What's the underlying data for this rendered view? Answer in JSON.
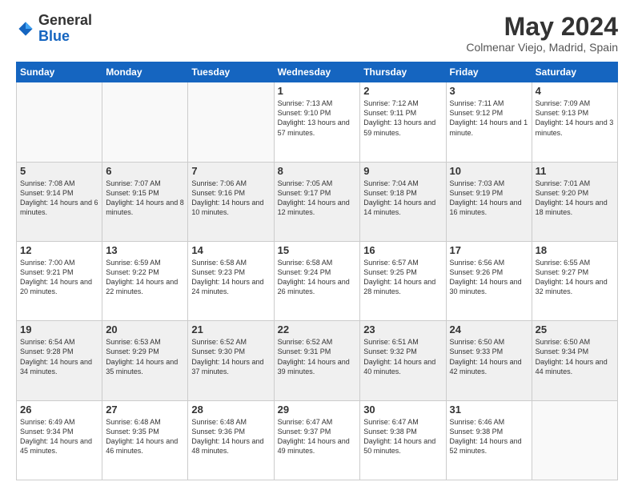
{
  "header": {
    "logo_general": "General",
    "logo_blue": "Blue",
    "month_title": "May 2024",
    "location": "Colmenar Viejo, Madrid, Spain"
  },
  "weekdays": [
    "Sunday",
    "Monday",
    "Tuesday",
    "Wednesday",
    "Thursday",
    "Friday",
    "Saturday"
  ],
  "weeks": [
    [
      {
        "day": "",
        "info": ""
      },
      {
        "day": "",
        "info": ""
      },
      {
        "day": "",
        "info": ""
      },
      {
        "day": "1",
        "info": "Sunrise: 7:13 AM\nSunset: 9:10 PM\nDaylight: 13 hours and 57 minutes."
      },
      {
        "day": "2",
        "info": "Sunrise: 7:12 AM\nSunset: 9:11 PM\nDaylight: 13 hours and 59 minutes."
      },
      {
        "day": "3",
        "info": "Sunrise: 7:11 AM\nSunset: 9:12 PM\nDaylight: 14 hours and 1 minute."
      },
      {
        "day": "4",
        "info": "Sunrise: 7:09 AM\nSunset: 9:13 PM\nDaylight: 14 hours and 3 minutes."
      }
    ],
    [
      {
        "day": "5",
        "info": "Sunrise: 7:08 AM\nSunset: 9:14 PM\nDaylight: 14 hours and 6 minutes."
      },
      {
        "day": "6",
        "info": "Sunrise: 7:07 AM\nSunset: 9:15 PM\nDaylight: 14 hours and 8 minutes."
      },
      {
        "day": "7",
        "info": "Sunrise: 7:06 AM\nSunset: 9:16 PM\nDaylight: 14 hours and 10 minutes."
      },
      {
        "day": "8",
        "info": "Sunrise: 7:05 AM\nSunset: 9:17 PM\nDaylight: 14 hours and 12 minutes."
      },
      {
        "day": "9",
        "info": "Sunrise: 7:04 AM\nSunset: 9:18 PM\nDaylight: 14 hours and 14 minutes."
      },
      {
        "day": "10",
        "info": "Sunrise: 7:03 AM\nSunset: 9:19 PM\nDaylight: 14 hours and 16 minutes."
      },
      {
        "day": "11",
        "info": "Sunrise: 7:01 AM\nSunset: 9:20 PM\nDaylight: 14 hours and 18 minutes."
      }
    ],
    [
      {
        "day": "12",
        "info": "Sunrise: 7:00 AM\nSunset: 9:21 PM\nDaylight: 14 hours and 20 minutes."
      },
      {
        "day": "13",
        "info": "Sunrise: 6:59 AM\nSunset: 9:22 PM\nDaylight: 14 hours and 22 minutes."
      },
      {
        "day": "14",
        "info": "Sunrise: 6:58 AM\nSunset: 9:23 PM\nDaylight: 14 hours and 24 minutes."
      },
      {
        "day": "15",
        "info": "Sunrise: 6:58 AM\nSunset: 9:24 PM\nDaylight: 14 hours and 26 minutes."
      },
      {
        "day": "16",
        "info": "Sunrise: 6:57 AM\nSunset: 9:25 PM\nDaylight: 14 hours and 28 minutes."
      },
      {
        "day": "17",
        "info": "Sunrise: 6:56 AM\nSunset: 9:26 PM\nDaylight: 14 hours and 30 minutes."
      },
      {
        "day": "18",
        "info": "Sunrise: 6:55 AM\nSunset: 9:27 PM\nDaylight: 14 hours and 32 minutes."
      }
    ],
    [
      {
        "day": "19",
        "info": "Sunrise: 6:54 AM\nSunset: 9:28 PM\nDaylight: 14 hours and 34 minutes."
      },
      {
        "day": "20",
        "info": "Sunrise: 6:53 AM\nSunset: 9:29 PM\nDaylight: 14 hours and 35 minutes."
      },
      {
        "day": "21",
        "info": "Sunrise: 6:52 AM\nSunset: 9:30 PM\nDaylight: 14 hours and 37 minutes."
      },
      {
        "day": "22",
        "info": "Sunrise: 6:52 AM\nSunset: 9:31 PM\nDaylight: 14 hours and 39 minutes."
      },
      {
        "day": "23",
        "info": "Sunrise: 6:51 AM\nSunset: 9:32 PM\nDaylight: 14 hours and 40 minutes."
      },
      {
        "day": "24",
        "info": "Sunrise: 6:50 AM\nSunset: 9:33 PM\nDaylight: 14 hours and 42 minutes."
      },
      {
        "day": "25",
        "info": "Sunrise: 6:50 AM\nSunset: 9:34 PM\nDaylight: 14 hours and 44 minutes."
      }
    ],
    [
      {
        "day": "26",
        "info": "Sunrise: 6:49 AM\nSunset: 9:34 PM\nDaylight: 14 hours and 45 minutes."
      },
      {
        "day": "27",
        "info": "Sunrise: 6:48 AM\nSunset: 9:35 PM\nDaylight: 14 hours and 46 minutes."
      },
      {
        "day": "28",
        "info": "Sunrise: 6:48 AM\nSunset: 9:36 PM\nDaylight: 14 hours and 48 minutes."
      },
      {
        "day": "29",
        "info": "Sunrise: 6:47 AM\nSunset: 9:37 PM\nDaylight: 14 hours and 49 minutes."
      },
      {
        "day": "30",
        "info": "Sunrise: 6:47 AM\nSunset: 9:38 PM\nDaylight: 14 hours and 50 minutes."
      },
      {
        "day": "31",
        "info": "Sunrise: 6:46 AM\nSunset: 9:38 PM\nDaylight: 14 hours and 52 minutes."
      },
      {
        "day": "",
        "info": ""
      }
    ]
  ]
}
